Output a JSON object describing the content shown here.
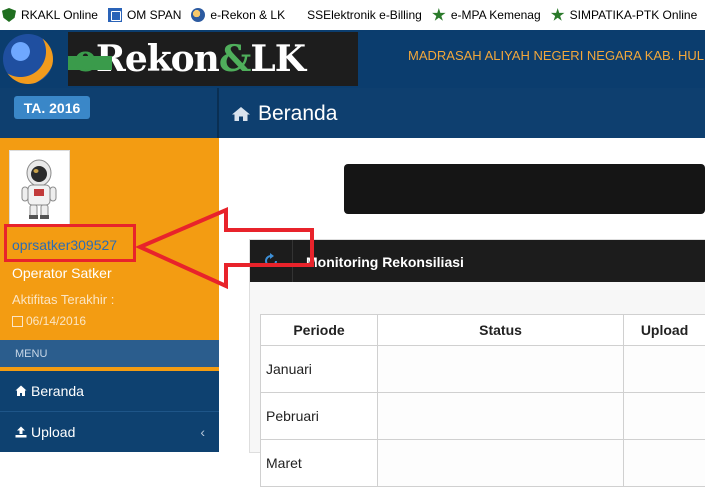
{
  "bookmarks": [
    {
      "label": "RKAKL Online",
      "icon": "shield-icon"
    },
    {
      "label": "OM SPAN",
      "icon": "om-span-icon"
    },
    {
      "label": "e-Rekon & LK",
      "icon": "globe-icon"
    },
    {
      "label": "SSElektronik e-Billing",
      "icon": ""
    },
    {
      "label": "e-MPA Kemenag",
      "icon": "kemenag-badge-icon"
    },
    {
      "label": "SIMPATIKA-PTK Online",
      "icon": "kemenag-badge-icon"
    }
  ],
  "header": {
    "brand_e": "e",
    "brand_rekon": "Rekon",
    "brand_amp": "&",
    "brand_lk": "LK",
    "institution": "MADRASAH ALIYAH NEGERI NEGARA KAB. HUL"
  },
  "subheader": {
    "year_badge": "TA. 2016",
    "page_title": "Beranda"
  },
  "user": {
    "username": "oprsatker309527",
    "role": "Operator Satker",
    "last_activity_label": "Aktifitas Terakhir :",
    "last_activity_date": "06/14/2016"
  },
  "menu": {
    "header": "MENU",
    "items": [
      {
        "label": "Beranda",
        "icon": "home-icon"
      },
      {
        "label": "Upload",
        "icon": "upload-icon",
        "has_chevron": true
      }
    ],
    "chevron": "‹"
  },
  "panel": {
    "title": "Monitoring Rekonsiliasi",
    "columns": [
      "Periode",
      "Status",
      "Upload"
    ],
    "rows": [
      {
        "periode": "Januari"
      },
      {
        "periode": "Pebruari"
      },
      {
        "periode": "Maret"
      }
    ]
  },
  "colors": {
    "header_bg": "#0b3d6e",
    "sidebar_bg": "#f39c12",
    "menu_bg": "#0e4170",
    "badge_bg": "#3a87c8",
    "annotation_red": "#e8232b",
    "institution_text": "#f2a73b"
  }
}
